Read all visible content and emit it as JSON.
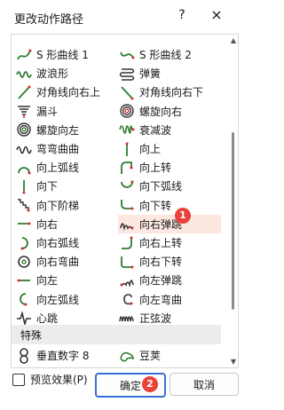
{
  "dialog": {
    "title": "更改动作路径",
    "help": "?",
    "close": "×"
  },
  "paths": [
    {
      "label": "S 形曲线 1",
      "icon": "s-curve-1-icon"
    },
    {
      "label": "S 形曲线 2",
      "icon": "s-curve-2-icon"
    },
    {
      "label": "波浪形",
      "icon": "wave-icon"
    },
    {
      "label": "弹簧",
      "icon": "spring-icon"
    },
    {
      "label": "对角线向右上",
      "icon": "diagonal-up-right-icon"
    },
    {
      "label": "对角线向右下",
      "icon": "diagonal-down-right-icon"
    },
    {
      "label": "漏斗",
      "icon": "funnel-icon"
    },
    {
      "label": "螺旋向右",
      "icon": "spiral-right-icon"
    },
    {
      "label": "螺旋向左",
      "icon": "spiral-left-icon"
    },
    {
      "label": "衰减波",
      "icon": "decaying-wave-icon"
    },
    {
      "label": "弯弯曲曲",
      "icon": "zigzag-curve-icon"
    },
    {
      "label": "向上",
      "icon": "up-icon"
    },
    {
      "label": "向上弧线",
      "icon": "arc-up-icon"
    },
    {
      "label": "向上转",
      "icon": "turn-up-icon"
    },
    {
      "label": "向下",
      "icon": "down-icon"
    },
    {
      "label": "向下弧线",
      "icon": "arc-down-icon"
    },
    {
      "label": "向下阶梯",
      "icon": "stairs-down-icon"
    },
    {
      "label": "向下转",
      "icon": "turn-down-icon"
    },
    {
      "label": "向右",
      "icon": "right-icon"
    },
    {
      "label": "向右弹跳",
      "icon": "bounce-right-icon"
    },
    {
      "label": "向右弧线",
      "icon": "arc-right-icon"
    },
    {
      "label": "向右上转",
      "icon": "turn-up-right-icon"
    },
    {
      "label": "向右弯曲",
      "icon": "curvy-right-icon"
    },
    {
      "label": "向右下转",
      "icon": "turn-down-right-icon"
    },
    {
      "label": "向左",
      "icon": "left-icon"
    },
    {
      "label": "向左弹跳",
      "icon": "bounce-left-icon"
    },
    {
      "label": "向左弧线",
      "icon": "arc-left-icon"
    },
    {
      "label": "向左弯曲",
      "icon": "curvy-left-icon"
    },
    {
      "label": "心跳",
      "icon": "heartbeat-icon"
    },
    {
      "label": "正弦波",
      "icon": "sine-wave-icon"
    }
  ],
  "section_special": "特殊",
  "special": [
    {
      "label": "垂直数字 8",
      "icon": "vertical-figure-8-icon"
    },
    {
      "label": "豆荚",
      "icon": "bean-icon"
    }
  ],
  "selected_label": "向右弹跳",
  "badges": {
    "one": "1",
    "two": "2"
  },
  "preview_label": "预览效果(P)",
  "preview_checked": false,
  "ok_label": "确定",
  "cancel_label": "取消",
  "colors": {
    "selected_bg": "#fde7e1",
    "badge": "#e8423a",
    "icon_green": "#2e7d32",
    "icon_red": "#d32f2f",
    "ok_border": "#3a6fd6"
  }
}
